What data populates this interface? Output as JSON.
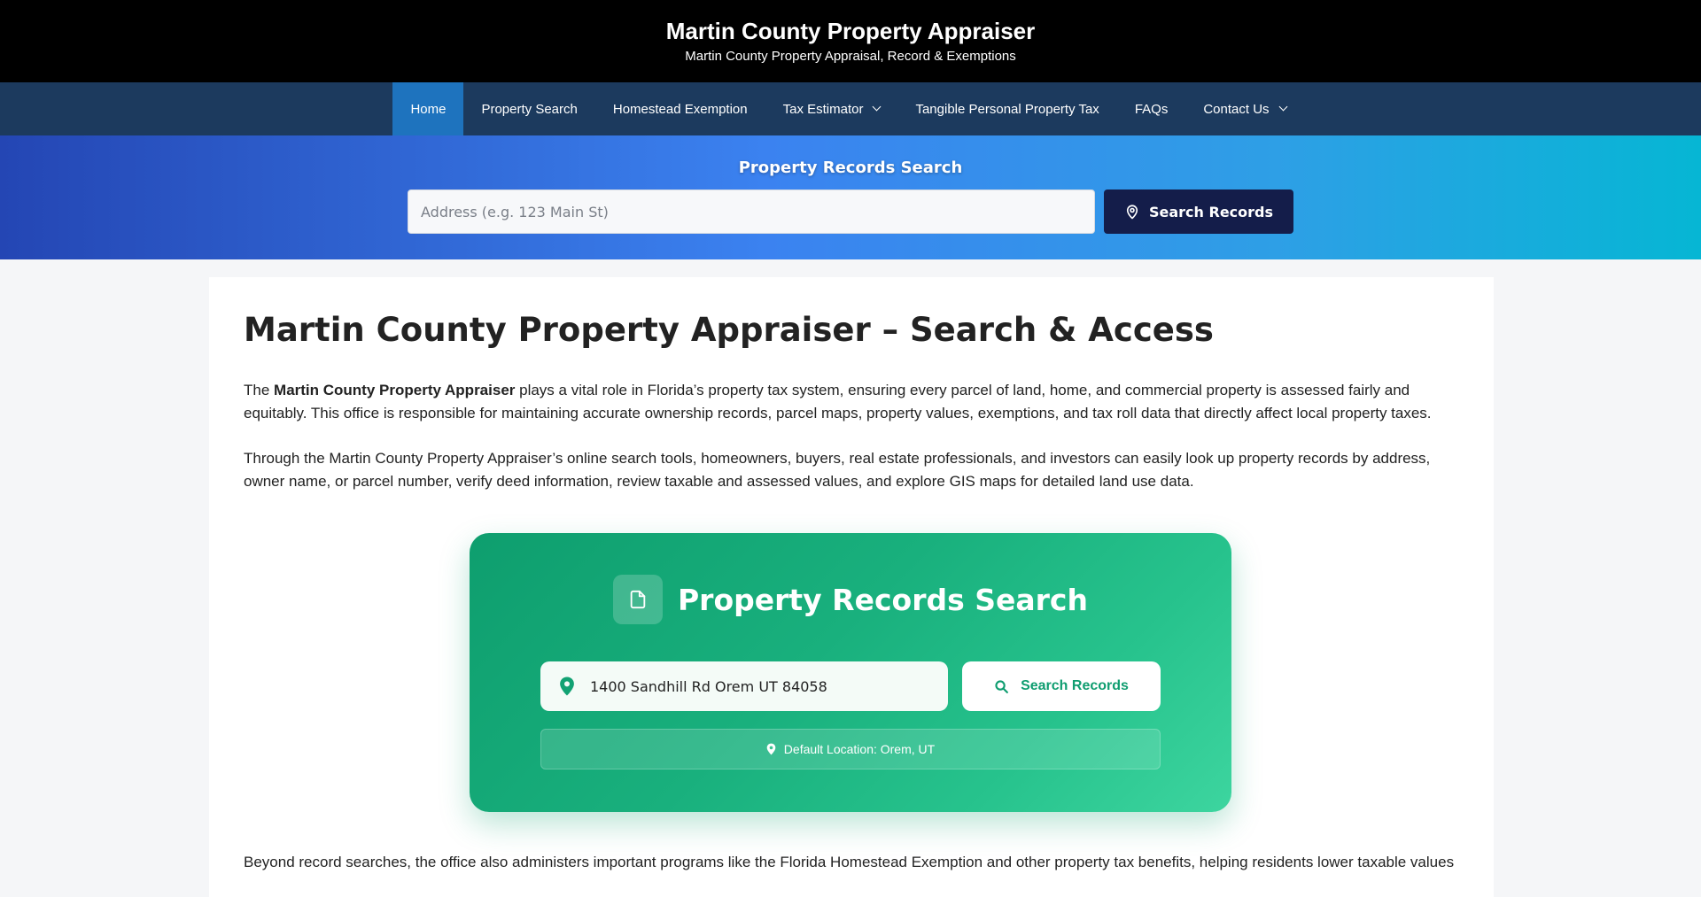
{
  "header": {
    "title": "Martin County Property Appraiser",
    "tagline": "Martin County Property Appraisal, Record & Exemptions"
  },
  "nav": {
    "items": [
      {
        "label": "Home",
        "active": true
      },
      {
        "label": "Property Search"
      },
      {
        "label": "Homestead Exemption"
      },
      {
        "label": "Tax Estimator",
        "dropdown": true
      },
      {
        "label": "Tangible Personal Property Tax"
      },
      {
        "label": "FAQs"
      },
      {
        "label": "Contact Us",
        "dropdown": true
      }
    ]
  },
  "hero": {
    "title": "Property Records Search",
    "placeholder": "Address (e.g. 123 Main St)",
    "button_label": "Search Records",
    "button_icon": "location-pin-icon"
  },
  "main": {
    "title": "Martin County Property Appraiser – Search & Access",
    "p1_pre": "The ",
    "p1_bold": "Martin County Property Appraiser",
    "p1_post": " plays a vital role in Florida’s property tax system, ensuring every parcel of land, home, and commercial property is assessed fairly and equitably. This office is responsible for maintaining accurate ownership records, parcel maps, property values, exemptions, and tax roll data that directly affect local property taxes.",
    "p2": "Through the Martin County Property Appraiser’s online search tools, homeowners, buyers, real estate professionals, and investors can easily look up property records by address, owner name, or parcel number, verify deed information, review taxable and assessed values, and explore GIS maps for detailed land use data.",
    "p3": "Beyond record searches, the office also administers important programs like the Florida Homestead Exemption and other property tax benefits, helping residents lower taxable values"
  },
  "card": {
    "title": "Property Records Search",
    "icon": "document-icon",
    "input_value": "1400 Sandhill Rd Orem UT 84058",
    "button_label": "Search Records",
    "default_location": "Default Location: Orem, UT"
  },
  "colors": {
    "header_bg": "#000000",
    "nav_bg": "#1c3a5e",
    "nav_active": "#1e73be",
    "hero_button": "#141d4a",
    "card_green": "#19b07d"
  }
}
